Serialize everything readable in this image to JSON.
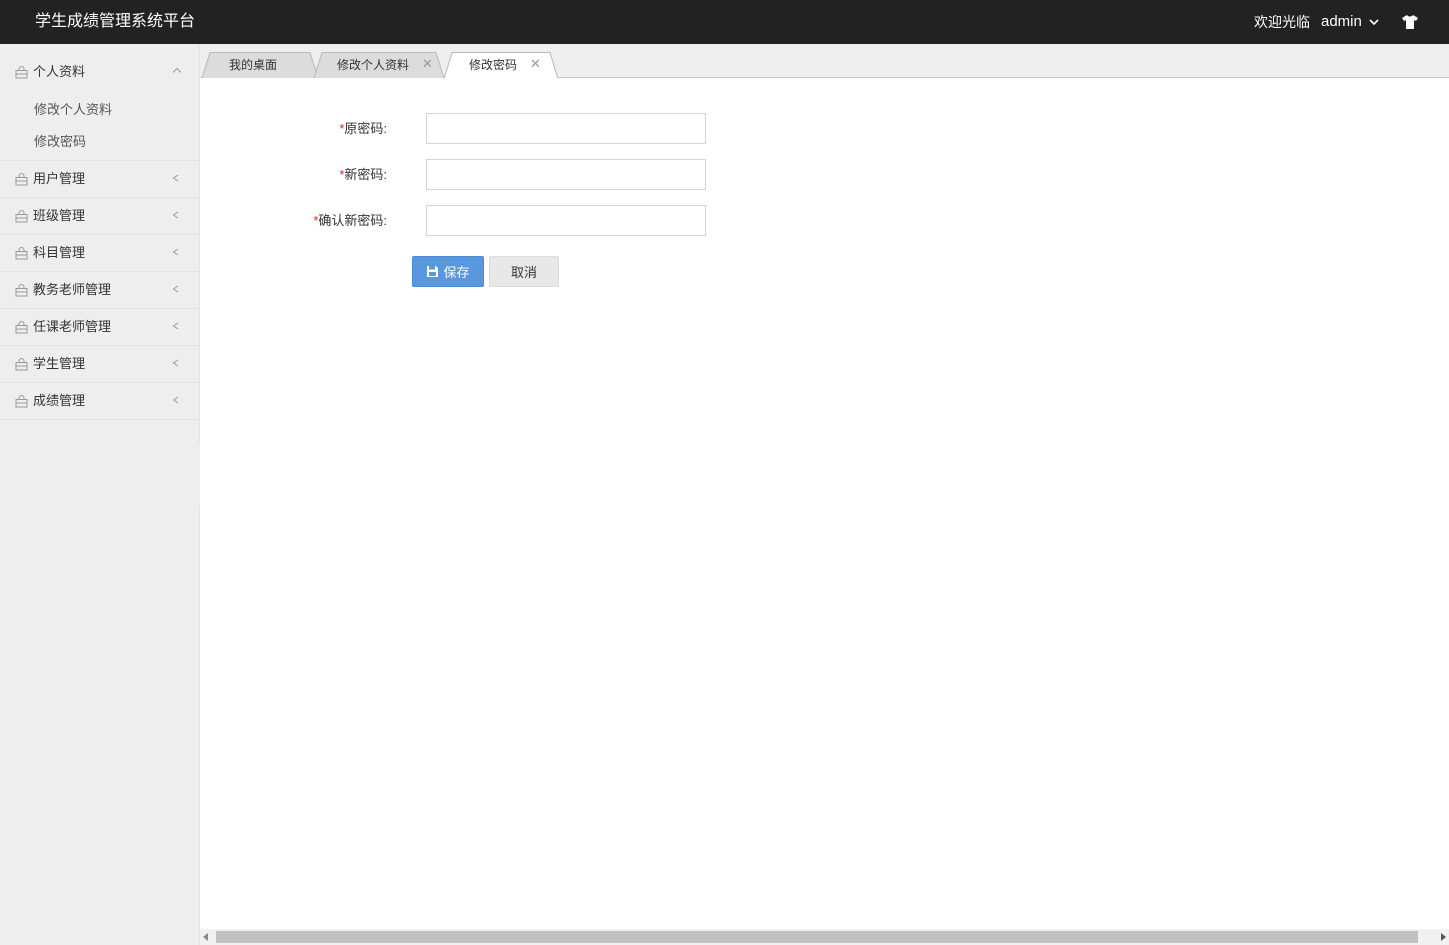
{
  "header": {
    "title": "学生成绩管理系统平台",
    "welcome": "欢迎光临",
    "username": "admin"
  },
  "sidebar": {
    "personal": {
      "label": "个人资料",
      "sub": [
        "修改个人资料",
        "修改密码"
      ]
    },
    "items": [
      {
        "label": "用户管理"
      },
      {
        "label": "班级管理"
      },
      {
        "label": "科目管理"
      },
      {
        "label": "教务老师管理"
      },
      {
        "label": "任课老师管理"
      },
      {
        "label": "学生管理"
      },
      {
        "label": "成绩管理"
      }
    ]
  },
  "tabs": [
    {
      "label": "我的桌面",
      "closable": false
    },
    {
      "label": "修改个人资料",
      "closable": true
    },
    {
      "label": "修改密码",
      "closable": true,
      "active": true
    }
  ],
  "form": {
    "required_mark": "*",
    "old_password_label": "原密码:",
    "new_password_label": "新密码:",
    "confirm_password_label": "确认新密码:",
    "old_password_value": "",
    "new_password_value": "",
    "confirm_password_value": "",
    "save_label": "保存",
    "cancel_label": "取消"
  },
  "colors": {
    "header_bg": "#222222",
    "sidebar_bg": "#eeeeee",
    "primary": "#5a98de",
    "required": "#e2231a"
  },
  "icons": {
    "menu": "bag-icon",
    "user_dropdown": "chevron-down-icon",
    "skin": "shirt-icon",
    "save": "floppy-disk-icon",
    "tab_close": "close-icon"
  }
}
